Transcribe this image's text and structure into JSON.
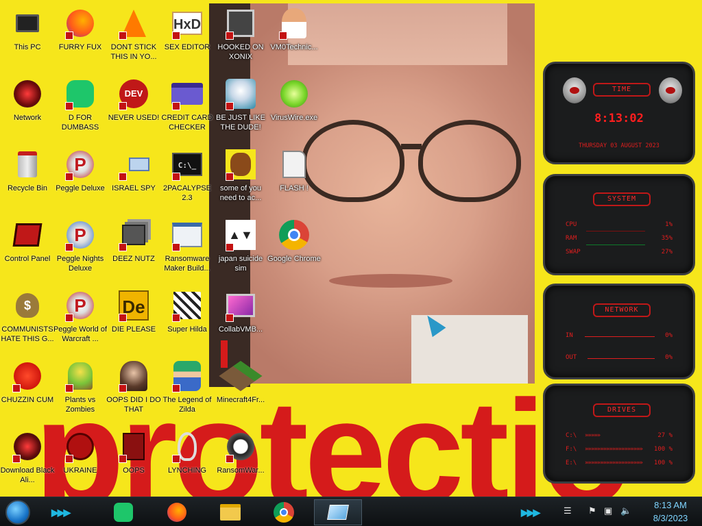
{
  "wallpaper": {
    "text": "protectio"
  },
  "desktop": {
    "icons": [
      {
        "label": "This PC"
      },
      {
        "label": "FURRY FUX"
      },
      {
        "label": "DONT STICK THIS IN YO..."
      },
      {
        "label": "SEX EDITOR"
      },
      {
        "label": "HOOKED ON XONIX"
      },
      {
        "label": "VM0Technic..."
      },
      {
        "label": "Network"
      },
      {
        "label": "D FOR DUMBASS"
      },
      {
        "label": "NEVER USED!"
      },
      {
        "label": "CREDIT CARD CHECKER"
      },
      {
        "label": "BE JUST LIKE THE DUDE!"
      },
      {
        "label": "VirusWire.exe"
      },
      {
        "label": "Recycle Bin"
      },
      {
        "label": "Peggle Deluxe"
      },
      {
        "label": "ISRAEL SPY"
      },
      {
        "label": "2PACALYPSE 2.3"
      },
      {
        "label": "some of you need to ac..."
      },
      {
        "label": "FLASH !"
      },
      {
        "label": "Control Panel"
      },
      {
        "label": "Peggle Nights Deluxe"
      },
      {
        "label": "DEEZ NUTZ"
      },
      {
        "label": "Ransomware Maker Build..."
      },
      {
        "label": "japan suicide sim"
      },
      {
        "label": "Google Chrome"
      },
      {
        "label": "COMMUNISTS HATE THIS G..."
      },
      {
        "label": "Peggle World of Warcraft ..."
      },
      {
        "label": "DIE PLEASE"
      },
      {
        "label": "Super Hilda"
      },
      {
        "label": "CollabVMB..."
      },
      {
        "label": "CHUZZIN CUM"
      },
      {
        "label": "Plants vs Zombies"
      },
      {
        "label": "OOPS DID I DO THAT"
      },
      {
        "label": "The Legend of Zilda"
      },
      {
        "label": "Minecraft4Fr..."
      },
      {
        "label": "Download Black Ali..."
      },
      {
        "label": "UKRAINE"
      },
      {
        "label": "OOPS"
      },
      {
        "label": "LYNCHING"
      },
      {
        "label": "RansomWar..."
      }
    ]
  },
  "gadgets": {
    "time": {
      "title": "TIME",
      "clock": "8:13:02",
      "date": "THURSDAY 03 AUGUST 2023"
    },
    "system": {
      "title": "SYSTEM",
      "rows": [
        {
          "label": "CPU",
          "value": "1%"
        },
        {
          "label": "RAM",
          "value": "35%"
        },
        {
          "label": "SWAP",
          "value": "27%"
        }
      ]
    },
    "network": {
      "title": "NETWORK",
      "rows": [
        {
          "label": "IN",
          "value": "0%"
        },
        {
          "label": "OUT",
          "value": "0%"
        }
      ]
    },
    "drives": {
      "title": "DRIVES",
      "rows": [
        {
          "label": "C:\\",
          "value": "27 %"
        },
        {
          "label": "F:\\",
          "value": "100 %"
        },
        {
          "label": "E:\\",
          "value": "100 %"
        }
      ]
    }
  },
  "taskbar": {
    "clock_time": "8:13 AM",
    "clock_date": "8/3/2023",
    "pinned": [
      "notes-app",
      "firefox",
      "file-explorer",
      "google-chrome",
      "virtual-machine"
    ]
  },
  "colors": {
    "desktop_bg": "#f6e61b",
    "accent_red": "#e01e1e",
    "taskbar_accent": "#1fb7e0"
  }
}
